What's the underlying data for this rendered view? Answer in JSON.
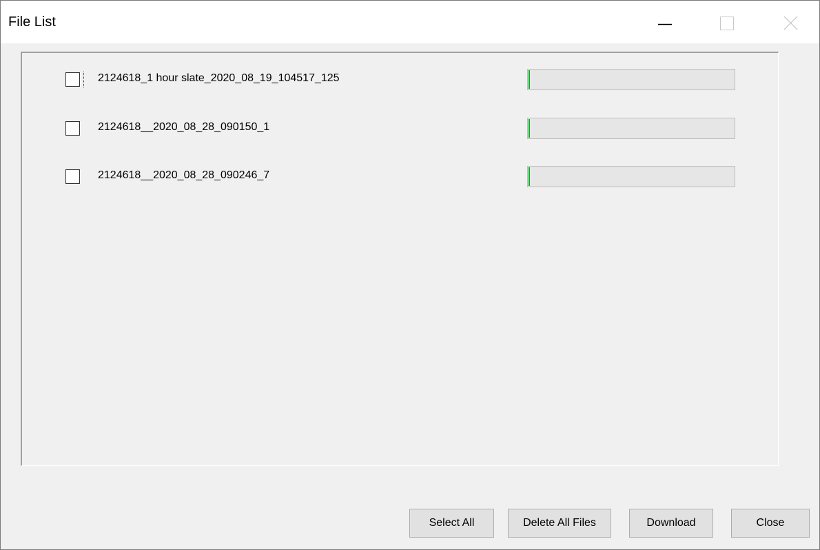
{
  "window": {
    "title": "File List",
    "controls": {
      "minimize": "minimize-icon",
      "maximize": "maximize-icon",
      "close": "close-icon"
    }
  },
  "files": [
    {
      "name": "2124618_1 hour slate_2020_08_19_104517_125",
      "checked": false,
      "progress": 0.005
    },
    {
      "name": "2124618__2020_08_28_090150_1",
      "checked": false,
      "progress": 0.005
    },
    {
      "name": "2124618__2020_08_28_090246_7",
      "checked": false,
      "progress": 0.005
    }
  ],
  "buttons": {
    "select_all": "Select All",
    "delete_all": "Delete All Files",
    "download": "Download",
    "close": "Close"
  },
  "colors": {
    "progress_fill": "#06b025",
    "progress_track": "#e6e6e6",
    "background": "#f0f0f0"
  }
}
